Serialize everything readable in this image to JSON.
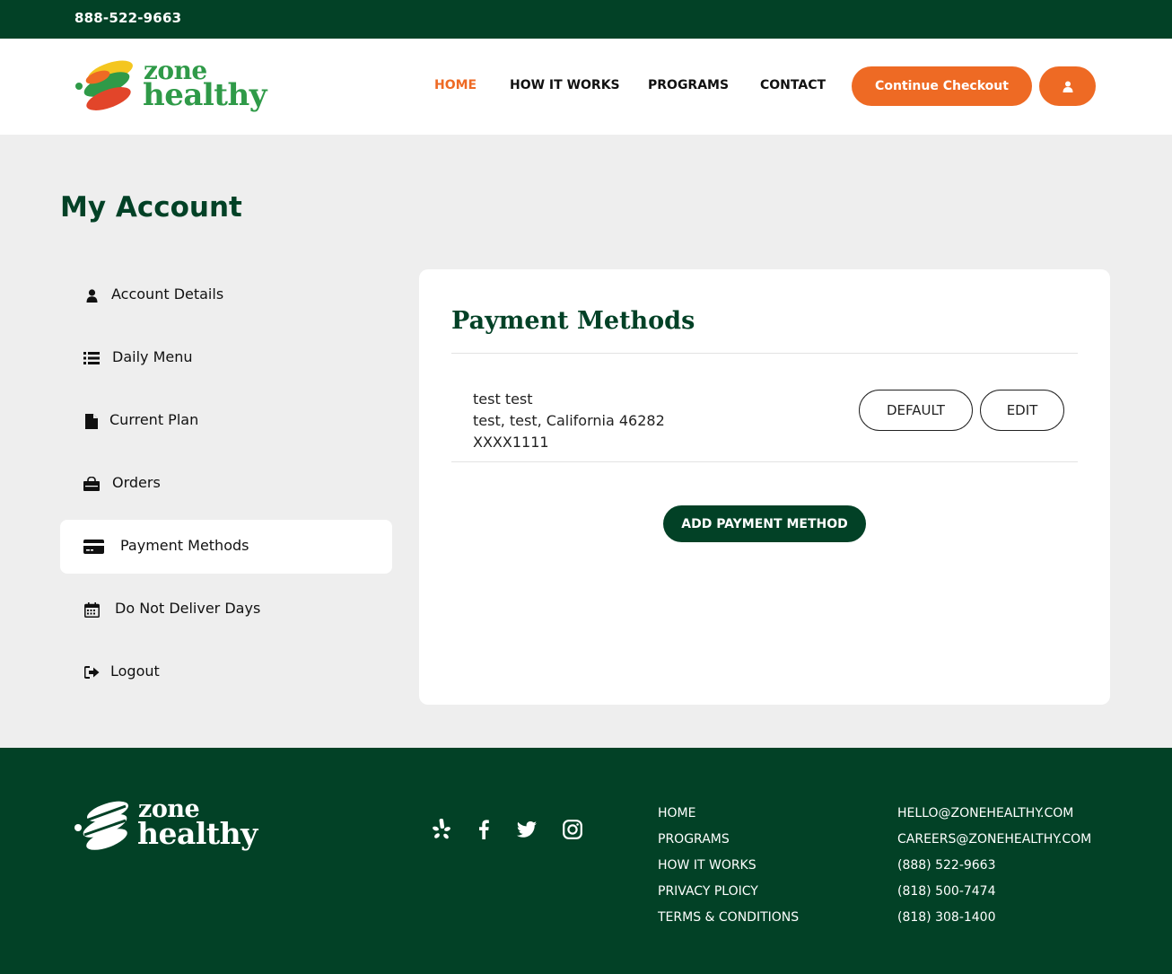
{
  "topbar": {
    "phone": "888-522-9663"
  },
  "brand": {
    "line1": "zone",
    "line2": "healthy"
  },
  "nav": {
    "home": "HOME",
    "how_it_works": "HOW IT WORKS",
    "programs": "PROGRAMS",
    "contact": "CONTACT",
    "checkout": "Continue Checkout",
    "active_color": "#ee6a24"
  },
  "page": {
    "title": "My Account"
  },
  "sidebar": {
    "items": [
      {
        "label": "Account Details",
        "icon": "user-icon"
      },
      {
        "label": "Daily Menu",
        "icon": "list-icon"
      },
      {
        "label": "Current Plan",
        "icon": "file-icon"
      },
      {
        "label": "Orders",
        "icon": "shopping-bag-icon"
      },
      {
        "label": "Payment Methods",
        "icon": "credit-card-icon",
        "active": true
      },
      {
        "label": "Do Not Deliver Days",
        "icon": "calendar-icon"
      },
      {
        "label": "Logout",
        "icon": "sign-out-icon"
      }
    ]
  },
  "payment": {
    "title": "Payment Methods",
    "methods": [
      {
        "name": "test test",
        "address": "test, test, California 46282",
        "card": "XXXX1111"
      }
    ],
    "default_label": "DEFAULT",
    "edit_label": "EDIT",
    "add_label": "ADD PAYMENT METHOD"
  },
  "footer": {
    "brand": {
      "line1": "zone",
      "line2": "healthy"
    },
    "social": [
      "yelp-icon",
      "facebook-icon",
      "twitter-icon",
      "instagram-icon"
    ],
    "links": [
      "HOME",
      "PROGRAMS",
      "HOW IT WORKS",
      "PRIVACY PLOICY",
      "TERMS & CONDITIONS"
    ],
    "contacts": [
      "HELLO@ZONEHEALTHY.COM",
      "CAREERS@ZONEHEALTHY.COM",
      "(888) 522-9663",
      "(818) 500-7474",
      "(818) 308-1400"
    ]
  },
  "colors": {
    "brand_green": "#024126",
    "accent_orange": "#ee6a24",
    "logo_green": "#2f9a48"
  }
}
